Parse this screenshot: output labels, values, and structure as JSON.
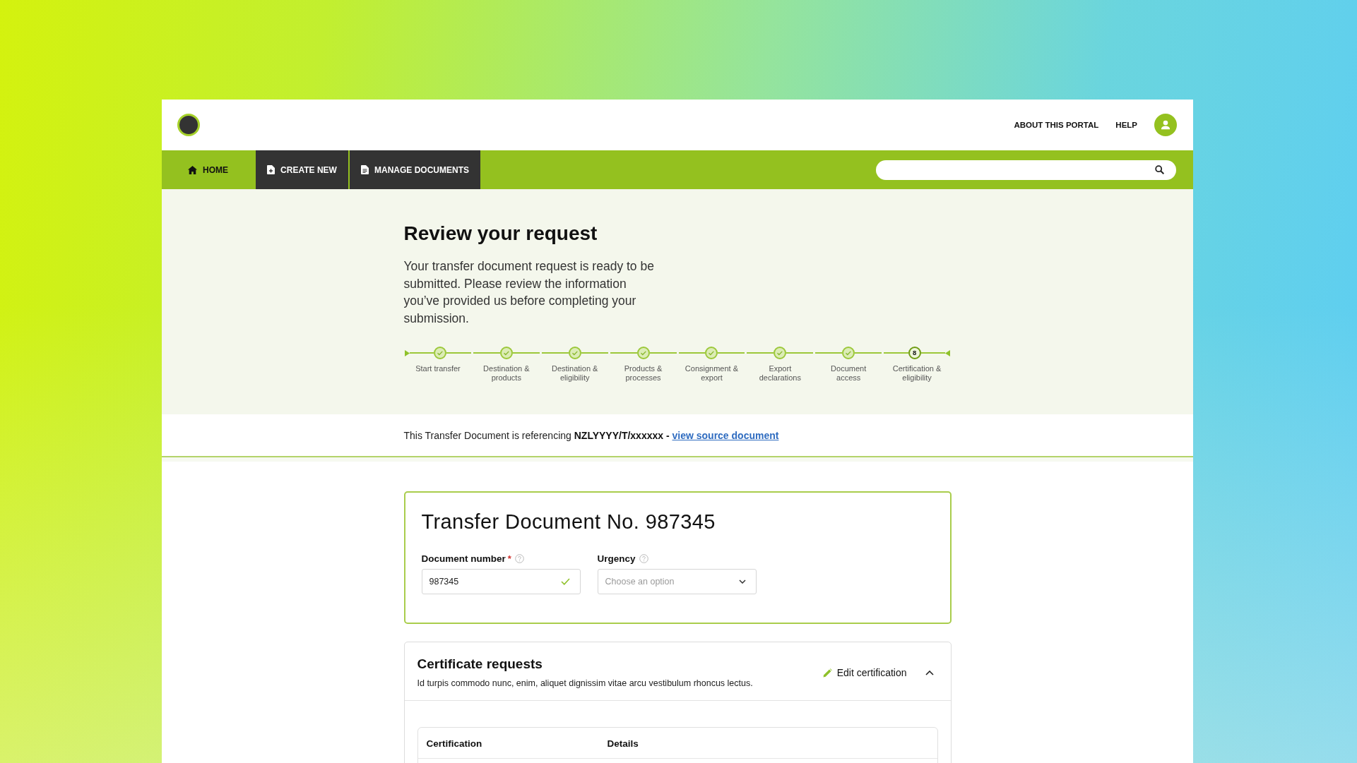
{
  "header": {
    "links": [
      "ABOUT THIS PORTAL",
      "HELP"
    ]
  },
  "nav": {
    "tabs": [
      {
        "kind": "home",
        "label": "HOME",
        "selected": true
      },
      {
        "kind": "create",
        "label": "CREATE NEW",
        "selected": false
      },
      {
        "kind": "documents",
        "label": "MANAGE DOCUMENTS",
        "selected": false
      }
    ]
  },
  "page": {
    "title": "Review your request",
    "intro": "Your transfer document request is ready to be submitted. Please review the information you’ve provided us before completing your submission."
  },
  "stepper": {
    "steps": [
      {
        "label": "Start transfer",
        "completed": true
      },
      {
        "label": "Destination & products",
        "completed": true
      },
      {
        "label": "Destination & eligibility",
        "completed": true
      },
      {
        "label": "Products & processes",
        "completed": true
      },
      {
        "label": "Consignment & export",
        "completed": true
      },
      {
        "label": "Export declarations",
        "completed": true
      },
      {
        "label": "Document access",
        "completed": true
      },
      {
        "label": "Certification & eligibility",
        "completed": false,
        "number": "8"
      }
    ]
  },
  "reference": {
    "text": "This Transfer Document is referencing **NZLYYYY/T/xxxxxx -**",
    "link": "view source document"
  },
  "document_card": {
    "title": "Transfer Document No. 987345",
    "fields": [
      {
        "kind": "text",
        "label": "Document number",
        "required_mark": "*",
        "value": "987345",
        "valid": true
      },
      {
        "kind": "select",
        "label": "Urgency",
        "placeholder": "Choose an option"
      }
    ]
  },
  "certificate_requests": {
    "title": "Certificate requests",
    "description": "Id turpis commodo nunc, enim, aliquet dignissim vitae arcu vestibulum rhoncus lectus.",
    "edit_label": "Edit certification",
    "expanded": true,
    "table": {
      "columns": [
        "Certification",
        "Details"
      ]
    }
  }
}
